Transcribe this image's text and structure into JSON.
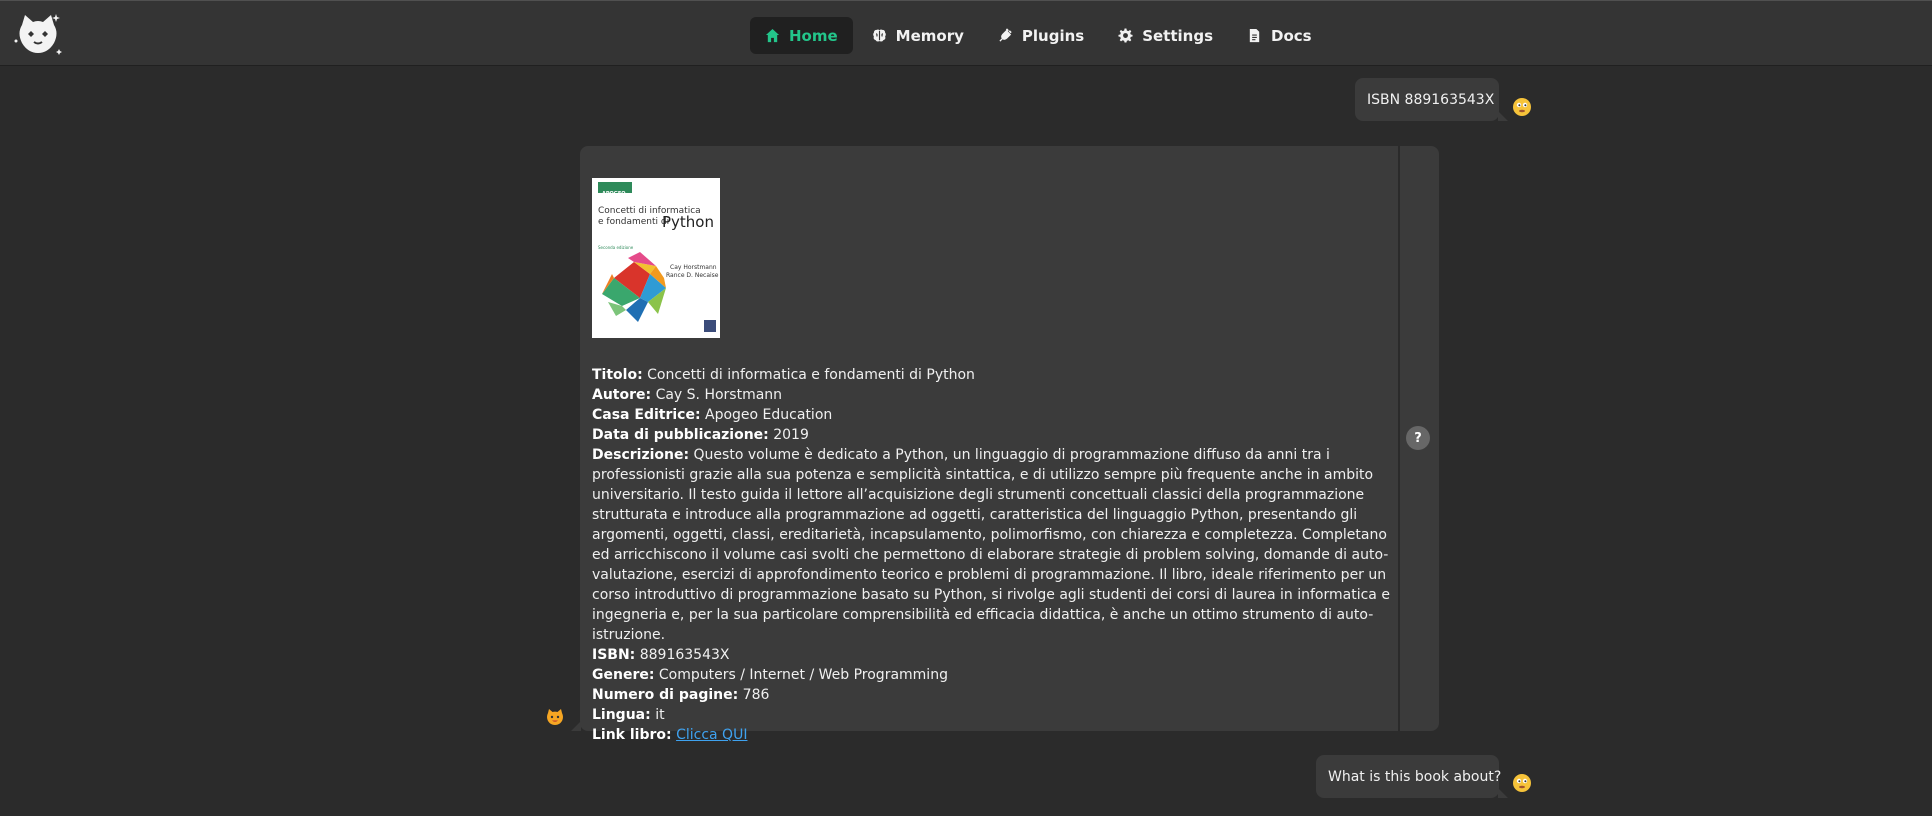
{
  "colors": {
    "accent": "#23c58a",
    "link": "#3fa2ef",
    "background": "#2b2b2b",
    "bubble": "#3b3b3b"
  },
  "nav": {
    "items": [
      {
        "label": "Home",
        "icon": "home-icon",
        "active": true
      },
      {
        "label": "Memory",
        "icon": "brain-icon",
        "active": false
      },
      {
        "label": "Plugins",
        "icon": "plug-icon",
        "active": false
      },
      {
        "label": "Settings",
        "icon": "gear-icon",
        "active": false
      },
      {
        "label": "Docs",
        "icon": "document-icon",
        "active": false
      }
    ]
  },
  "chat": {
    "message1": {
      "text": "ISBN 889163543X"
    },
    "bot": {
      "cover": {
        "publisher_tag": "APOGEO",
        "title_line1": "Concetti di informatica",
        "title_line2": "e fondamenti di",
        "title_big": "Python",
        "edition": "Seconda edizione",
        "author1": "Cay Horstmann",
        "author2": "Rance D. Necaise"
      },
      "title_label": "Titolo:",
      "title_value": "Concetti di informatica e fondamenti di Python",
      "author_label": "Autore:",
      "author_value": "Cay S. Horstmann",
      "publisher_label": "Casa Editrice:",
      "publisher_value": "Apogeo Education",
      "date_label": "Data di pubblicazione:",
      "date_value": "2019",
      "desc_label": "Descrizione:",
      "desc_value": "Questo volume è dedicato a Python, un linguaggio di programmazione diffuso da anni tra i professionisti grazie alla sua potenza e semplicità sintattica, e di utilizzo sempre più frequente anche in ambito universitario. Il testo guida il lettore all’acquisizione degli strumenti concettuali classici della programmazione strutturata e introduce alla programmazione ad oggetti, caratteristica del linguaggio Python, presentando gli argomenti, oggetti, classi, ereditarietà, incapsulamento, polimorfismo, con chiarezza e completezza. Completano ed arricchiscono il volume casi svolti che permettono di elaborare strategie di problem solving, domande di auto-valutazione, esercizi di approfondimento teorico e problemi di programmazione. Il libro, ideale riferimento per un corso introduttivo di programmazione basato su Python, si rivolge agli studenti dei corsi di laurea in informatica e ingegneria e, per la sua particolare comprensibilità ed efficacia didattica, è anche un ottimo strumento di auto-istruzione.",
      "isbn_label": "ISBN:",
      "isbn_value": "889163543X",
      "genre_label": "Genere:",
      "genre_value": "Computers / Internet / Web Programming",
      "pages_label": "Numero di pagine:",
      "pages_value": "786",
      "lang_label": "Lingua:",
      "lang_value": "it",
      "link_label": "Link libro:",
      "link_value": "Clicca QUI",
      "help": "?"
    },
    "message2": {
      "text": "What is this book about?"
    }
  }
}
